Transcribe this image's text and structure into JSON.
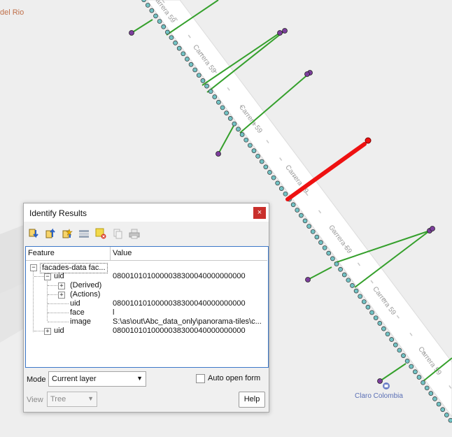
{
  "map": {
    "labels": {
      "corner_place": "del Rio",
      "street": "Carrera 59",
      "poi": "Claro Colombia"
    },
    "colors": {
      "street": "#ffffff",
      "street_edge": "#dcdcdc",
      "point_fill": "#72c2c4",
      "point_stroke": "#333333",
      "link": "#35a02c",
      "endpoint": "#7c3e9c",
      "selected": "#ee1111"
    }
  },
  "dialog": {
    "title": "Identify Results",
    "close_glyph": "×",
    "toolbar_icons": [
      "expand-tree-icon",
      "collapse-tree-icon",
      "expand-new-icon",
      "open-form-icon",
      "clear-results-icon",
      "copy-feature-icon",
      "print-icon"
    ],
    "columns": {
      "feature": "Feature",
      "value": "Value"
    },
    "tree": [
      {
        "feature": "facades-data fac...",
        "value": ""
      },
      {
        "feature": "uid",
        "value": "0800101010000038300040000000000"
      },
      {
        "feature": "(Derived)",
        "value": ""
      },
      {
        "feature": "(Actions)",
        "value": ""
      },
      {
        "feature": "uid",
        "value": "0800101010000038300040000000000"
      },
      {
        "feature": "face",
        "value": "l"
      },
      {
        "feature": "image",
        "value": "S:\\as\\out\\Abc_data_only\\panorama-tiles\\c..."
      },
      {
        "feature": "uid",
        "value": "0800101010000038300040000000000"
      }
    ],
    "mode": {
      "label": "Mode",
      "value": "Current layer"
    },
    "auto_open": {
      "label": "Auto open form",
      "checked": false
    },
    "view": {
      "label": "View",
      "value": "Tree"
    },
    "help": "Help"
  }
}
